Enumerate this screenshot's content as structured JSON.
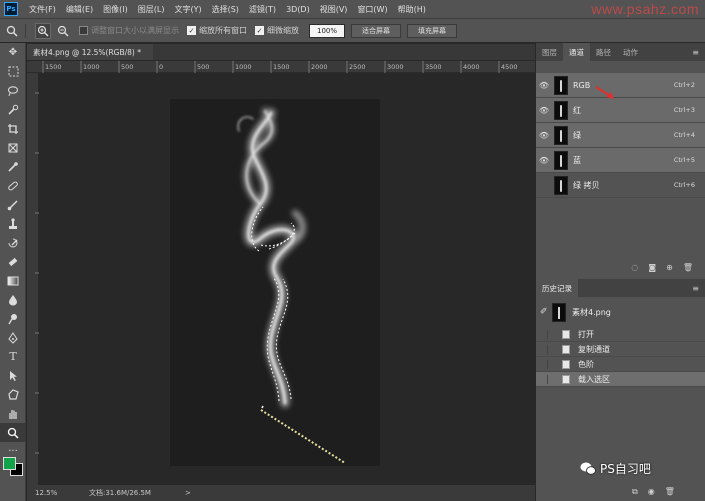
{
  "app": {
    "logo": "Ps",
    "menu": [
      "文件(F)",
      "编辑(E)",
      "图像(I)",
      "图层(L)",
      "文字(Y)",
      "选择(S)",
      "滤镜(T)",
      "3D(D)",
      "视图(V)",
      "窗口(W)",
      "帮助(H)"
    ],
    "watermark_top": "www.psahz.com"
  },
  "options": {
    "check_resize": "调整窗口大小以满屏显示",
    "check_all_windows": "缩放所有窗口",
    "check_scrubby": "细微缩放",
    "zoom_value": "100%",
    "btn_fit": "适合屏幕",
    "btn_fill": "填充屏幕"
  },
  "document": {
    "tab_title": "素材4.png @ 12.5%(RGB/8) *",
    "ruler_top": [
      "1500",
      "1000",
      "500",
      "0",
      "500",
      "1000",
      "1500",
      "2000",
      "2500",
      "3000",
      "3500",
      "4000",
      "4500"
    ],
    "status_zoom": "12.5%",
    "status_doc": "文档:31.6M/26.5M",
    "status_arrow": ">"
  },
  "panels": {
    "tabs": [
      "图层",
      "通道",
      "路径",
      "动作"
    ],
    "active_tab": "通道",
    "channels": [
      {
        "name": "RGB",
        "shortcut": "Ctrl+2"
      },
      {
        "name": "红",
        "shortcut": "Ctrl+3"
      },
      {
        "name": "绿",
        "shortcut": "Ctrl+4"
      },
      {
        "name": "蓝",
        "shortcut": "Ctrl+5"
      },
      {
        "name": "绿 拷贝",
        "shortcut": "Ctrl+6"
      }
    ],
    "history_title": "历史记录",
    "history_snapshot": "素材4.png",
    "history_items": [
      "打开",
      "复制通道",
      "色阶",
      "载入选区"
    ]
  },
  "overlay": {
    "wechat_label": "PS自习吧"
  },
  "colors": {
    "foreground": "#11a24a",
    "background": "#000000"
  }
}
